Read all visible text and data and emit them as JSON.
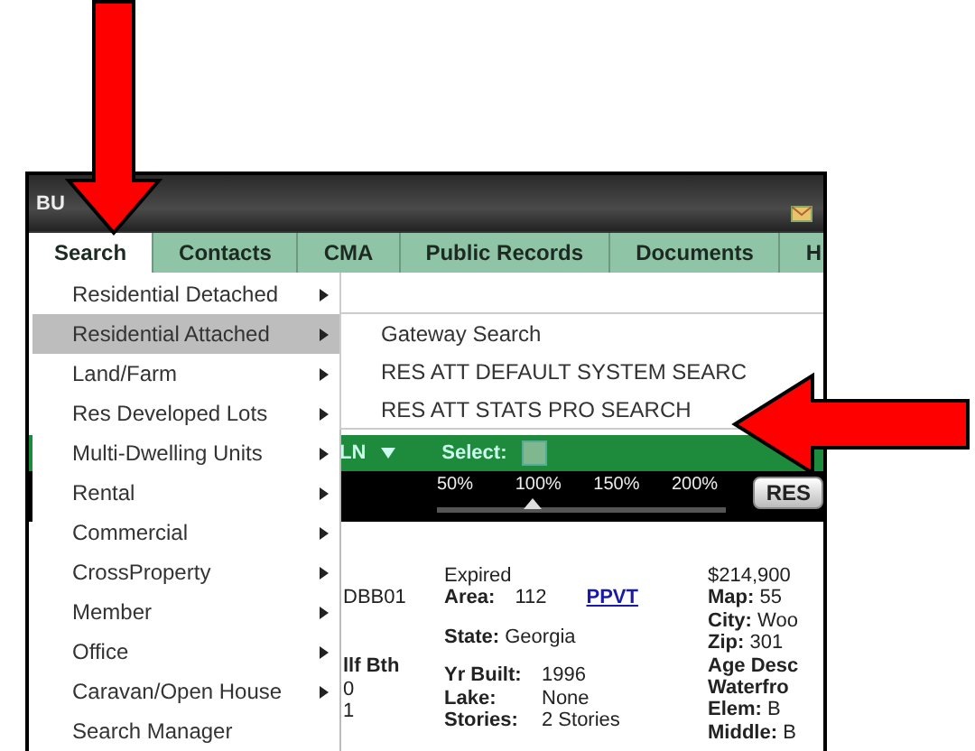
{
  "header": {
    "title": "BU"
  },
  "tabs": [
    {
      "label": "Search",
      "selected": true
    },
    {
      "label": "Contacts",
      "selected": false
    },
    {
      "label": "CMA",
      "selected": false
    },
    {
      "label": "Public Records",
      "selected": false
    },
    {
      "label": "Documents",
      "selected": false
    },
    {
      "label": "H",
      "selected": false
    }
  ],
  "menu": {
    "items": [
      {
        "label": "Residential Detached",
        "submenu": true,
        "selected": false
      },
      {
        "label": "Residential Attached",
        "submenu": true,
        "selected": true
      },
      {
        "label": "Land/Farm",
        "submenu": true,
        "selected": false
      },
      {
        "label": "Res Developed Lots",
        "submenu": true,
        "selected": false
      },
      {
        "label": "Multi-Dwelling Units",
        "submenu": true,
        "selected": false
      },
      {
        "label": "Rental",
        "submenu": true,
        "selected": false
      },
      {
        "label": "Commercial",
        "submenu": true,
        "selected": false
      },
      {
        "label": "CrossProperty",
        "submenu": true,
        "selected": false
      },
      {
        "label": "Member",
        "submenu": true,
        "selected": false
      },
      {
        "label": "Office",
        "submenu": true,
        "selected": false
      },
      {
        "label": "Caravan/Open House",
        "submenu": true,
        "selected": false
      },
      {
        "label": "Search Manager",
        "submenu": false,
        "selected": false
      }
    ]
  },
  "submenu": {
    "items": [
      "Gateway Search",
      "RES ATT DEFAULT SYSTEM SEARC",
      "RES ATT STATS PRO SEARCH"
    ]
  },
  "toolbar": {
    "view": "LN",
    "select_label": "Select:",
    "select_checked": false
  },
  "zoom": {
    "labels": [
      "50%",
      "100%",
      "150%",
      "200%"
    ],
    "level": 0.33,
    "button": "RES"
  },
  "listing": {
    "column_1": [
      "DBB01",
      "llf Bth",
      "0",
      "1"
    ],
    "status": "Expired",
    "area_label": "Area:",
    "area": "112",
    "link": "PPVT",
    "state_label": "State:",
    "state": "Georgia",
    "details": [
      {
        "label": "Yr Built:",
        "value": "1996"
      },
      {
        "label": "Lake:",
        "value": "None"
      },
      {
        "label": "Stories:",
        "value": "2 Stories"
      }
    ],
    "price": "$214,900",
    "column_3": [
      {
        "label": "Map:",
        "value": "55"
      },
      {
        "label": "City:",
        "value": "Woo"
      },
      {
        "label": "Zip:",
        "value": "301"
      },
      {
        "label": "Age Desc"
      },
      {
        "label": "Waterfro"
      },
      {
        "label": "Elem:",
        "value": "B"
      },
      {
        "label": "Middle:",
        "value": "B"
      }
    ]
  }
}
